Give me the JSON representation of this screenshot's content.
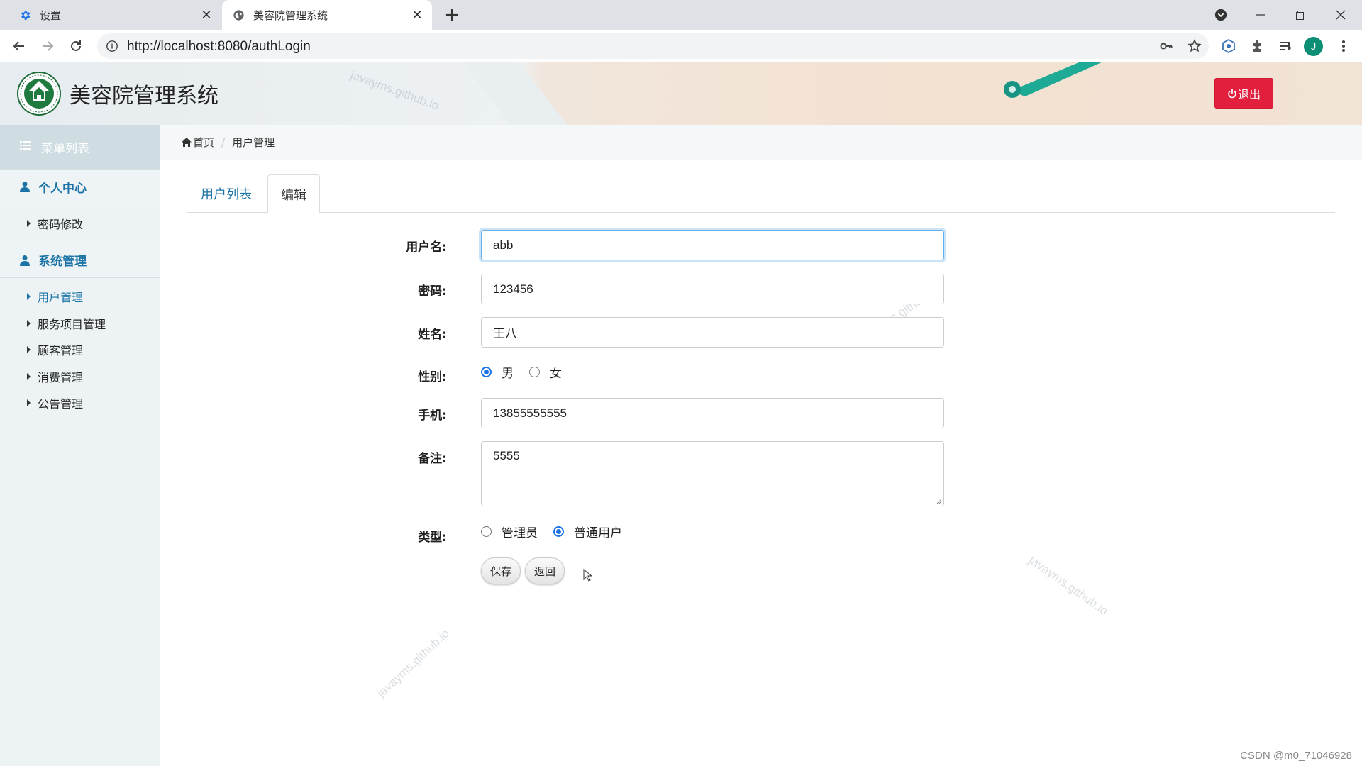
{
  "browser": {
    "tabs": [
      {
        "title": "设置",
        "icon": "gear-icon",
        "active": false
      },
      {
        "title": "美容院管理系统",
        "icon": "globe-icon",
        "active": true
      }
    ],
    "url": "http://localhost:8080/authLogin",
    "avatar_letter": "J"
  },
  "header": {
    "app_title": "美容院管理系统",
    "logout_label": "退出",
    "watermark": "javayms.github.io"
  },
  "sidebar": {
    "menu_title": "菜单列表",
    "groups": [
      {
        "label": "个人中心",
        "items": [
          {
            "label": "密码修改",
            "active": false
          }
        ]
      },
      {
        "label": "系统管理",
        "items": [
          {
            "label": "用户管理",
            "active": true
          },
          {
            "label": "服务项目管理",
            "active": false
          },
          {
            "label": "顾客管理",
            "active": false
          },
          {
            "label": "消费管理",
            "active": false
          },
          {
            "label": "公告管理",
            "active": false
          }
        ]
      }
    ]
  },
  "breadcrumb": {
    "home": "首页",
    "current": "用户管理"
  },
  "tabs": {
    "list": "用户列表",
    "edit": "编辑"
  },
  "form": {
    "username": {
      "label": "用户名:",
      "value": "abb"
    },
    "password": {
      "label": "密码:",
      "value": "123456"
    },
    "name": {
      "label": "姓名:",
      "value": "王八"
    },
    "gender": {
      "label": "性别:",
      "options": [
        "男",
        "女"
      ],
      "selected": "男"
    },
    "phone": {
      "label": "手机:",
      "value": "13855555555"
    },
    "remark": {
      "label": "备注:",
      "value": "5555"
    },
    "type": {
      "label": "类型:",
      "options": [
        "管理员",
        "普通用户"
      ],
      "selected": "普通用户"
    },
    "save_label": "保存",
    "back_label": "返回"
  },
  "footer": {
    "credit": "CSDN @m0_71046928"
  },
  "colors": {
    "accent": "#1b73a6",
    "logout": "#e21f3d",
    "radio": "#1a73e8"
  }
}
